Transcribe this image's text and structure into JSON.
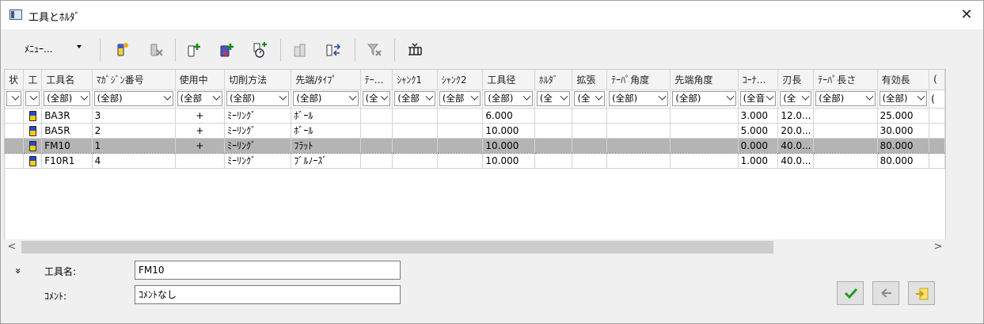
{
  "window": {
    "title": "工具とﾎﾙﾀﾞ",
    "close": "✕"
  },
  "toolbar": {
    "menu_label": "ﾒﾆｭｰ...",
    "buttons": [
      {
        "name": "new-tool-button",
        "icon": "tool-add-icon"
      },
      {
        "name": "delete-tool-button",
        "icon": "tool-delete-icon"
      },
      {
        "name": "add-to-list-button",
        "icon": "tool-plus-icon"
      },
      {
        "name": "add-holder-button",
        "icon": "holder-plus-icon"
      },
      {
        "name": "measure-tool-button",
        "icon": "tool-measure-icon"
      },
      {
        "name": "copy-tool-button",
        "icon": "tool-copy-icon"
      },
      {
        "name": "swap-tool-button",
        "icon": "tool-swap-icon"
      },
      {
        "name": "clear-filter-button",
        "icon": "filter-clear-icon"
      },
      {
        "name": "column-settings-button",
        "icon": "columns-icon"
      }
    ]
  },
  "table": {
    "columns": [
      "状",
      "工",
      "工具名",
      "ﾏｶﾞｼﾞﾝ番号",
      "使用中",
      "切削方法",
      "先端/ﾀｲﾌﾟ",
      "ﾃｰ…",
      "ｼｬﾝｸ1",
      "ｼｬﾝｸ2",
      "工具径",
      "ﾎﾙﾀﾞ",
      "拡張",
      "ﾃｰﾊﾟ角度",
      "先端角度",
      "ｺｰﾅ…",
      "刃長",
      "ﾃｰﾊﾟ長さ",
      "有効長",
      "("
    ],
    "filters": [
      "",
      "",
      "(全部)",
      "(全部)",
      "(全部",
      "(全部)",
      "(全部)",
      "(全",
      "(全部",
      "(全部",
      "(全部)",
      "(全",
      "(全",
      "(全部)",
      "(全部)",
      "(全音",
      "(全",
      "(全部)",
      "(全部)",
      "("
    ],
    "rows": [
      {
        "name": "BA3R",
        "magazine": "3",
        "in_use": "+",
        "method": "ﾐｰﾘﾝｸﾞ",
        "tip": "ﾎﾞｰﾙ",
        "diameter": "6.000",
        "corner": "3.000",
        "flute": "12.0...",
        "effective": "25.000",
        "selected": false
      },
      {
        "name": "BA5R",
        "magazine": "2",
        "in_use": "+",
        "method": "ﾐｰﾘﾝｸﾞ",
        "tip": "ﾎﾞｰﾙ",
        "diameter": "10.000",
        "corner": "5.000",
        "flute": "20.0...",
        "effective": "30.000",
        "selected": false
      },
      {
        "name": "FM10",
        "magazine": "1",
        "in_use": "+",
        "method": "ﾐｰﾘﾝｸﾞ",
        "tip": "ﾌﾗｯﾄ",
        "diameter": "10.000",
        "corner": "0.000",
        "flute": "40.0...",
        "effective": "80.000",
        "selected": true
      },
      {
        "name": "F10R1",
        "magazine": "4",
        "in_use": "",
        "method": "ﾐｰﾘﾝｸﾞ",
        "tip": "ﾌﾞﾙﾉｰｽﾞ",
        "diameter": "10.000",
        "corner": "1.000",
        "flute": "40.0...",
        "effective": "80.000",
        "selected": false
      }
    ]
  },
  "details": {
    "expand_icon": "»",
    "tool_name_label": "工具名:",
    "tool_name_value": "FM10",
    "comment_label": "ｺﾒﾝﾄ:",
    "comment_value": "ｺﾒﾝﾄなし"
  },
  "colors": {
    "selected_row": "#b4b4b4",
    "ok_green": "#1e9e1e",
    "accent_yellow": "#f0c020"
  }
}
